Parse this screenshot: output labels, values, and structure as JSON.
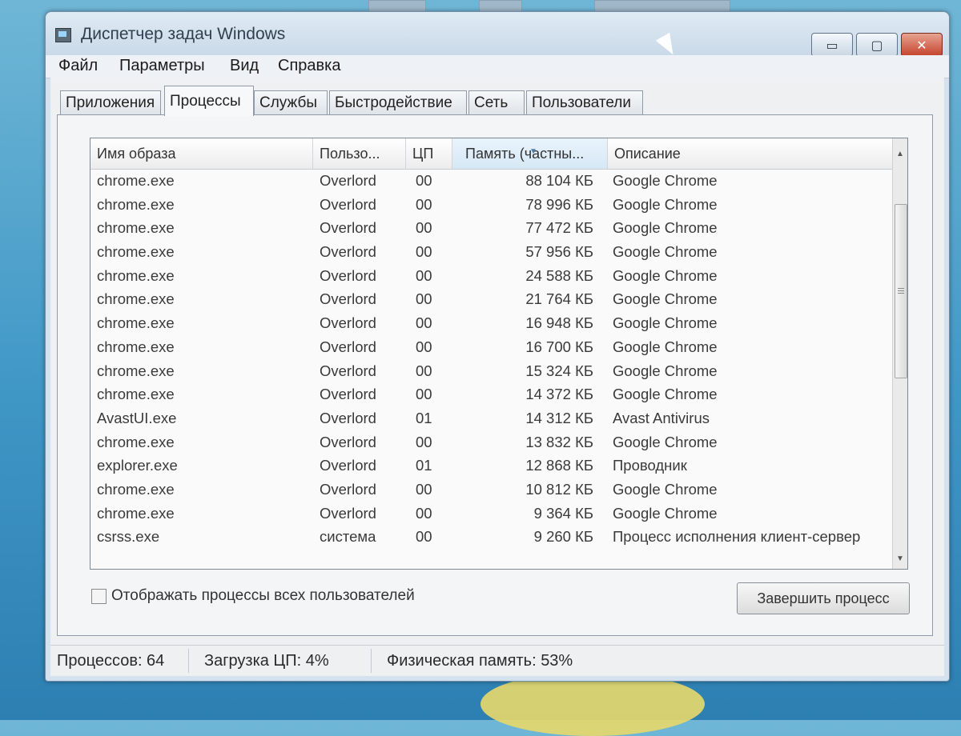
{
  "window": {
    "title": "Диспетчер задач Windows",
    "controls": {
      "minimize": "▭",
      "maximize": "▢",
      "close": "✕"
    }
  },
  "menu": [
    "Файл",
    "Параметры",
    "Вид",
    "Справка"
  ],
  "tabs": [
    "Приложения",
    "Процессы",
    "Службы",
    "Быстродействие",
    "Сеть",
    "Пользователи"
  ],
  "active_tab": "Процессы",
  "columns": [
    "Имя образа",
    "Пользо...",
    "ЦП",
    "Память (частны...",
    "Описание"
  ],
  "sorted_column": "Память (частны...",
  "processes": [
    {
      "name": "chrome.exe",
      "user": "Overlord",
      "cpu": "00",
      "memory": "88 104 КБ",
      "description": "Google Chrome"
    },
    {
      "name": "chrome.exe",
      "user": "Overlord",
      "cpu": "00",
      "memory": "78 996 КБ",
      "description": "Google Chrome"
    },
    {
      "name": "chrome.exe",
      "user": "Overlord",
      "cpu": "00",
      "memory": "77 472 КБ",
      "description": "Google Chrome"
    },
    {
      "name": "chrome.exe",
      "user": "Overlord",
      "cpu": "00",
      "memory": "57 956 КБ",
      "description": "Google Chrome"
    },
    {
      "name": "chrome.exe",
      "user": "Overlord",
      "cpu": "00",
      "memory": "24 588 КБ",
      "description": "Google Chrome"
    },
    {
      "name": "chrome.exe",
      "user": "Overlord",
      "cpu": "00",
      "memory": "21 764 КБ",
      "description": "Google Chrome"
    },
    {
      "name": "chrome.exe",
      "user": "Overlord",
      "cpu": "00",
      "memory": "16 948 КБ",
      "description": "Google Chrome"
    },
    {
      "name": "chrome.exe",
      "user": "Overlord",
      "cpu": "00",
      "memory": "16 700 КБ",
      "description": "Google Chrome"
    },
    {
      "name": "chrome.exe",
      "user": "Overlord",
      "cpu": "00",
      "memory": "15 324 КБ",
      "description": "Google Chrome"
    },
    {
      "name": "chrome.exe",
      "user": "Overlord",
      "cpu": "00",
      "memory": "14 372 КБ",
      "description": "Google Chrome"
    },
    {
      "name": "AvastUI.exe",
      "user": "Overlord",
      "cpu": "01",
      "memory": "14 312 КБ",
      "description": "Avast Antivirus"
    },
    {
      "name": "chrome.exe",
      "user": "Overlord",
      "cpu": "00",
      "memory": "13 832 КБ",
      "description": "Google Chrome"
    },
    {
      "name": "explorer.exe",
      "user": "Overlord",
      "cpu": "01",
      "memory": "12 868 КБ",
      "description": "Проводник"
    },
    {
      "name": "chrome.exe",
      "user": "Overlord",
      "cpu": "00",
      "memory": "10 812 КБ",
      "description": "Google Chrome"
    },
    {
      "name": "chrome.exe",
      "user": "Overlord",
      "cpu": "00",
      "memory": "9 364 КБ",
      "description": "Google Chrome"
    },
    {
      "name": "csrss.exe",
      "user": "система",
      "cpu": "00",
      "memory": "9 260 КБ",
      "description": "Процесс исполнения клиент-сервер"
    }
  ],
  "show_all_users_label": "Отображать процессы всех пользователей",
  "show_all_users_checked": false,
  "end_process_label": "Завершить процесс",
  "status": {
    "processes": "Процессов: 64",
    "cpu_load": "Загрузка ЦП: 4%",
    "physical_memory": "Физическая память: 53%"
  }
}
